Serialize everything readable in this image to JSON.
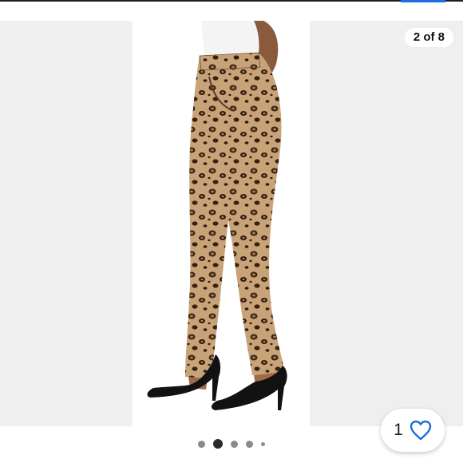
{
  "gallery": {
    "counter_text": "2 of 8",
    "pagination": {
      "total_dots": 5,
      "active_index": 1
    },
    "image_description": "leopard-print-pants-photo"
  },
  "likes": {
    "count": "1",
    "icon": "heart-outline-icon"
  },
  "colors": {
    "accent": "#1b6fe0",
    "heart": "#1b6fe0",
    "background": "#efefef"
  }
}
